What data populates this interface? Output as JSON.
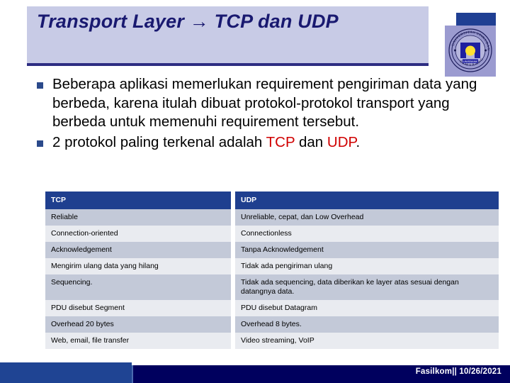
{
  "slide": {
    "title": "Transport Layer → TCP dan UDP",
    "title_color": "#191970",
    "title_box_color": "#c8cbe6",
    "accent_color": "#1f3f8f",
    "highlight_color": "#d00000"
  },
  "logo": {
    "name": "unisbank-semarang-seal",
    "outer_text_top": "UNIVERSITAS  STIKUBANK",
    "outer_text_bottom": "SEMARANG",
    "inner_text": "UNISBANK"
  },
  "bullets": [
    {
      "marker": "square-bullet",
      "segments": [
        {
          "text": "Beberapa aplikasi memerlukan requirement pengiriman data yang berbeda, karena itulah dibuat protokol-protokol transport yang berbeda untuk memenuhi requirement tersebut.",
          "highlight": false
        }
      ]
    },
    {
      "marker": "square-bullet",
      "segments": [
        {
          "text": "2 protokol paling terkenal adalah ",
          "highlight": false
        },
        {
          "text": "TCP",
          "highlight": true
        },
        {
          "text": " dan ",
          "highlight": false
        },
        {
          "text": "UDP",
          "highlight": true
        },
        {
          "text": ".",
          "highlight": false
        }
      ]
    }
  ],
  "table": {
    "headers": [
      "TCP",
      "UDP"
    ],
    "rows": [
      [
        "Reliable",
        "Unreliable, cepat, dan Low Overhead"
      ],
      [
        "Connection-oriented",
        "Connectionless"
      ],
      [
        "Acknowledgement",
        "Tanpa Acknowledgement"
      ],
      [
        "Mengirim ulang data yang hilang",
        "Tidak ada pengiriman ulang"
      ],
      [
        "Sequencing.",
        "Tidak ada sequencing, data diberikan ke layer atas sesuai dengan datangnya data."
      ],
      [
        "PDU disebut Segment",
        "PDU disebut Datagram"
      ],
      [
        "Overhead 20 bytes",
        "Overhead 8 bytes."
      ],
      [
        "Web, email, file transfer",
        "Video streaming, VoIP"
      ]
    ]
  },
  "footer": {
    "text": "Fasilkom|| 10/26/2021",
    "bar_color": "#00005e",
    "accent_color": "#1f4493"
  }
}
